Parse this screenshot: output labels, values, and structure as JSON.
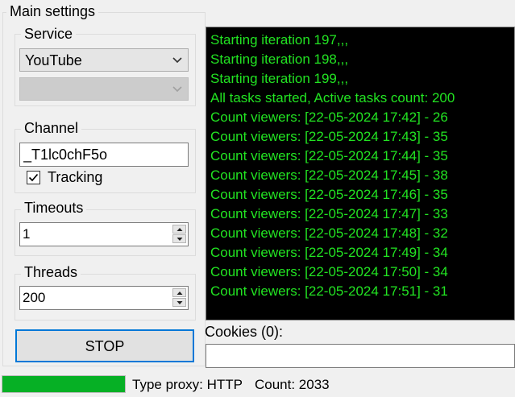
{
  "main_settings": {
    "title": "Main settings"
  },
  "service": {
    "title": "Service",
    "selected": "YouTube",
    "secondary_selected": ""
  },
  "channel": {
    "title": "Channel",
    "value": "_T1lc0chF5o",
    "tracking_label": "Tracking",
    "tracking_checked": true
  },
  "timeouts": {
    "title": "Timeouts",
    "value": "1"
  },
  "threads": {
    "title": "Threads",
    "value": "200"
  },
  "stop_button": {
    "label": "STOP"
  },
  "console": {
    "text_color": "#22e322",
    "lines": [
      "Starting iteration 197,,,",
      "Starting iteration 198,,,",
      "Starting iteration 199,,,",
      "All tasks started, Active tasks count: 200",
      "Count viewers: [22-05-2024 17:42] - 26",
      "Count viewers: [22-05-2024 17:43] - 35",
      "Count viewers: [22-05-2024 17:44] - 35",
      "Count viewers: [22-05-2024 17:45] - 38",
      "Count viewers: [22-05-2024 17:46] - 35",
      "Count viewers: [22-05-2024 17:47] - 33",
      "Count viewers: [22-05-2024 17:48] - 32",
      "Count viewers: [22-05-2024 17:49] - 34",
      "Count viewers: [22-05-2024 17:50] - 34",
      "Count viewers: [22-05-2024 17:51] - 31"
    ]
  },
  "cookies": {
    "label": "Cookies (0):",
    "value": ""
  },
  "status_bar": {
    "progress_fraction": 1.0,
    "progress_color": "#06b025",
    "proxy_type": "Type proxy: HTTP",
    "count": "Count: 2033"
  },
  "icons": {
    "combo_arrow": "chevron-down-icon",
    "checkmark": "checkmark-icon",
    "spin_up": "spin-up-arrow-icon",
    "spin_down": "spin-down-arrow-icon"
  }
}
